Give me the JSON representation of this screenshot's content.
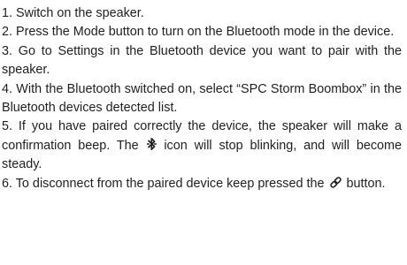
{
  "steps": [
    {
      "text": "1. Switch on the speaker."
    },
    {
      "text": "2. Press the Mode button to turn on the Bluetooth mode in the device."
    },
    {
      "text": "3. Go to Settings in the Bluetooth device you want to pair with the speaker."
    },
    {
      "text": "4. With the Bluetooth switched on, select “SPC Storm Boombox” in the Bluetooth devices detected list."
    },
    {
      "text_before": "5. If you have paired correctly the device, the speaker will make a confirmation beep. The",
      "icon": "bluetooth-icon",
      "text_after": "icon will stop blinking, and will become steady."
    },
    {
      "text_before": "6. To disconnect from the paired device keep pressed the",
      "icon": "link-icon",
      "text_after": "button."
    }
  ]
}
